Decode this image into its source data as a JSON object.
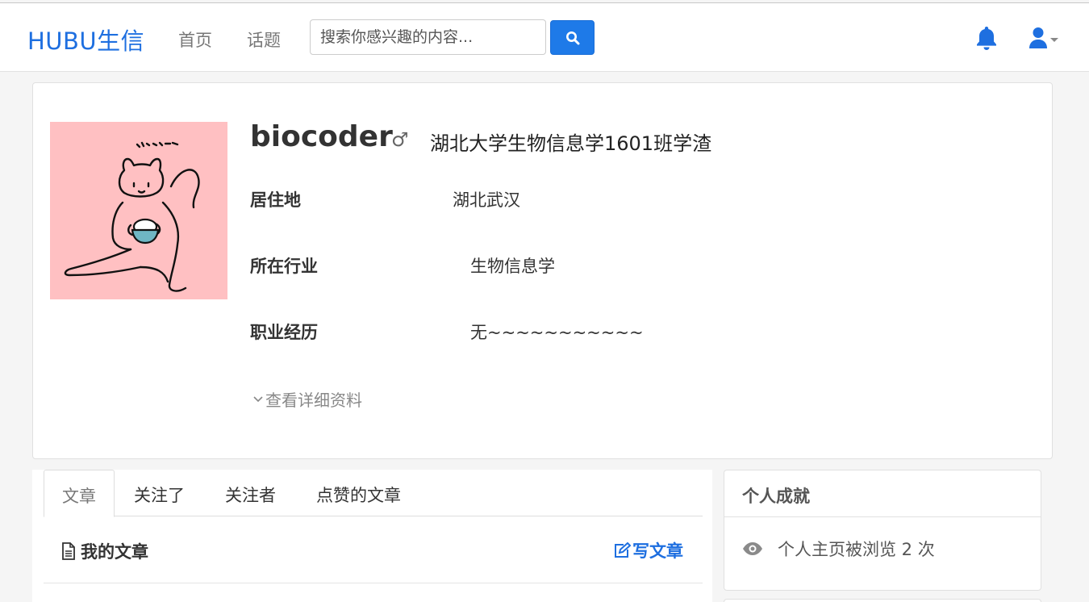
{
  "nav": {
    "brand": "HUBU生信",
    "home": "首页",
    "topics": "话题",
    "search_placeholder": "搜索你感兴趣的内容...",
    "icons": {
      "search": "search-icon",
      "bell": "bell-icon",
      "user": "user-icon",
      "caret": "caret-down-icon"
    },
    "accent": "#1e7ae8"
  },
  "profile": {
    "username": "biocoder",
    "gender": "♂",
    "bio": "湖北大学生物信息学1601班学渣",
    "fields": {
      "residence_label": "居住地",
      "residence_value": "湖北武汉",
      "industry_label": "所在行业",
      "industry_value": "生物信息学",
      "career_label": "职业经历",
      "career_value": "无~~~~~~~~~~~"
    },
    "more_link": "查看详细资料",
    "avatar_bg": "#ffc0c2"
  },
  "tabs": [
    "文章",
    "关注了",
    "关注者",
    "点赞的文章"
  ],
  "articles": {
    "title": "我的文章",
    "write": "写文章"
  },
  "achievements": {
    "title": "个人成就",
    "views": "个人主页被浏览 2 次"
  }
}
